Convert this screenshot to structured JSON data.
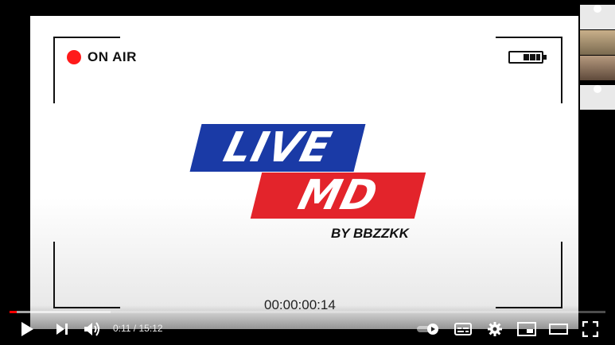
{
  "video": {
    "on_air_label": "ON AIR",
    "logo_line1": "LIVE",
    "logo_line2": "MD",
    "byline": "BY BBZZKK",
    "timecode": "00:00:00:14",
    "colors": {
      "logo_blue": "#1a3aa6",
      "logo_red": "#e3242b",
      "rec_dot": "#ff1a1a"
    }
  },
  "player": {
    "current_time": "0:11",
    "duration": "15:12",
    "time_display": "0:11 / 15:12",
    "played_fraction": 0.012,
    "buffered_fraction": 0.17,
    "progress_color": "#ff0000"
  },
  "controls": {
    "play_icon": "play-icon",
    "next_icon": "next-icon",
    "volume_icon": "volume-icon",
    "autoplay_icon": "autoplay-toggle-icon",
    "captions_icon": "captions-icon",
    "settings_icon": "gear-icon",
    "miniplayer_icon": "miniplayer-icon",
    "theater_icon": "theater-mode-icon",
    "fullscreen_icon": "fullscreen-icon"
  },
  "participants": {
    "count_shown": 4
  }
}
